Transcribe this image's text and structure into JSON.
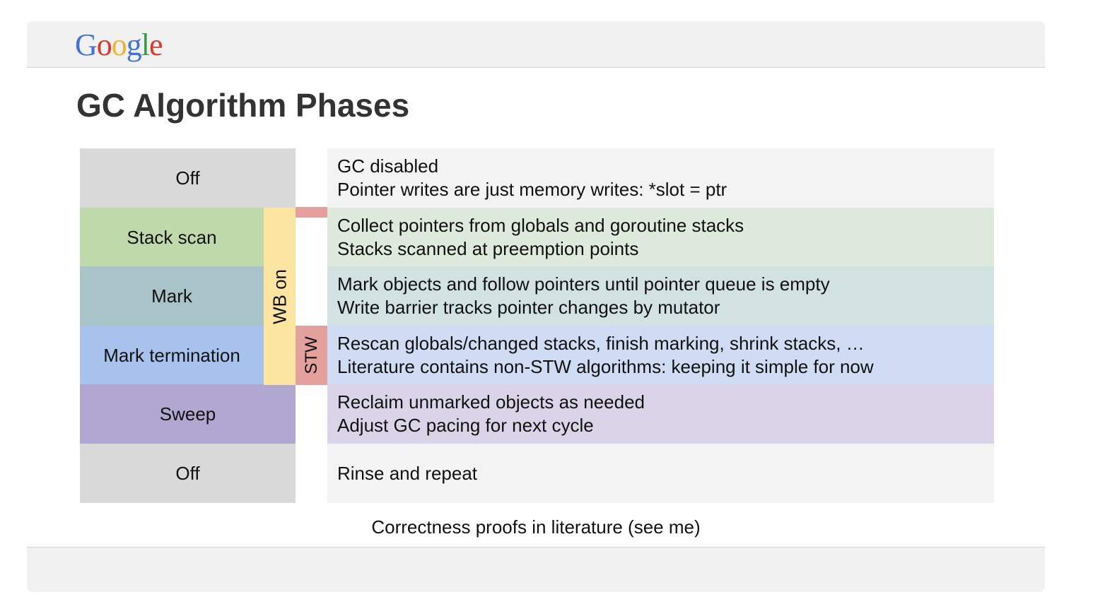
{
  "logo": {
    "letters": [
      {
        "char": "G",
        "color": "#3f73d8"
      },
      {
        "char": "o",
        "color": "#d93a2b"
      },
      {
        "char": "o",
        "color": "#f2b233"
      },
      {
        "char": "g",
        "color": "#3f73d8"
      },
      {
        "char": "l",
        "color": "#3a9b46"
      },
      {
        "char": "e",
        "color": "#d93a2b"
      }
    ]
  },
  "title": "GC Algorithm Phases",
  "phases": [
    {
      "label": "Off",
      "color": "#d9d9d9",
      "desc_color": "#f3f3f3",
      "lines": [
        "GC disabled",
        "Pointer writes are just memory writes: *slot = ptr"
      ]
    },
    {
      "label": "Stack scan",
      "color": "#c0d9aa",
      "desc_color": "#deeadb",
      "lines": [
        "Collect pointers from globals and goroutine stacks",
        "Stacks scanned at preemption points"
      ]
    },
    {
      "label": "Mark",
      "color": "#a9c4c8",
      "desc_color": "#d2e1e1",
      "lines": [
        "Mark objects and follow pointers until pointer queue is empty",
        "Write barrier tracks pointer changes by mutator"
      ]
    },
    {
      "label": "Mark termination",
      "color": "#a7c3ed",
      "desc_color": "#cfdcf4",
      "lines": [
        "Rescan globals/changed stacks, finish marking, shrink stacks, …",
        "Literature contains non-STW algorithms: keeping it simple for now"
      ]
    },
    {
      "label": "Sweep",
      "color": "#b1a8d2",
      "desc_color": "#d9d4e8",
      "lines": [
        "Reclaim unmarked objects as needed",
        "Adjust GC pacing for next cycle"
      ]
    },
    {
      "label": "Off",
      "color": "#d9d9d9",
      "desc_color": "#f3f3f3",
      "lines": [
        "Rinse and repeat"
      ]
    }
  ],
  "wb_label": "WB on",
  "stw_label": "STW",
  "footnote": "Correctness proofs in literature (see me)"
}
